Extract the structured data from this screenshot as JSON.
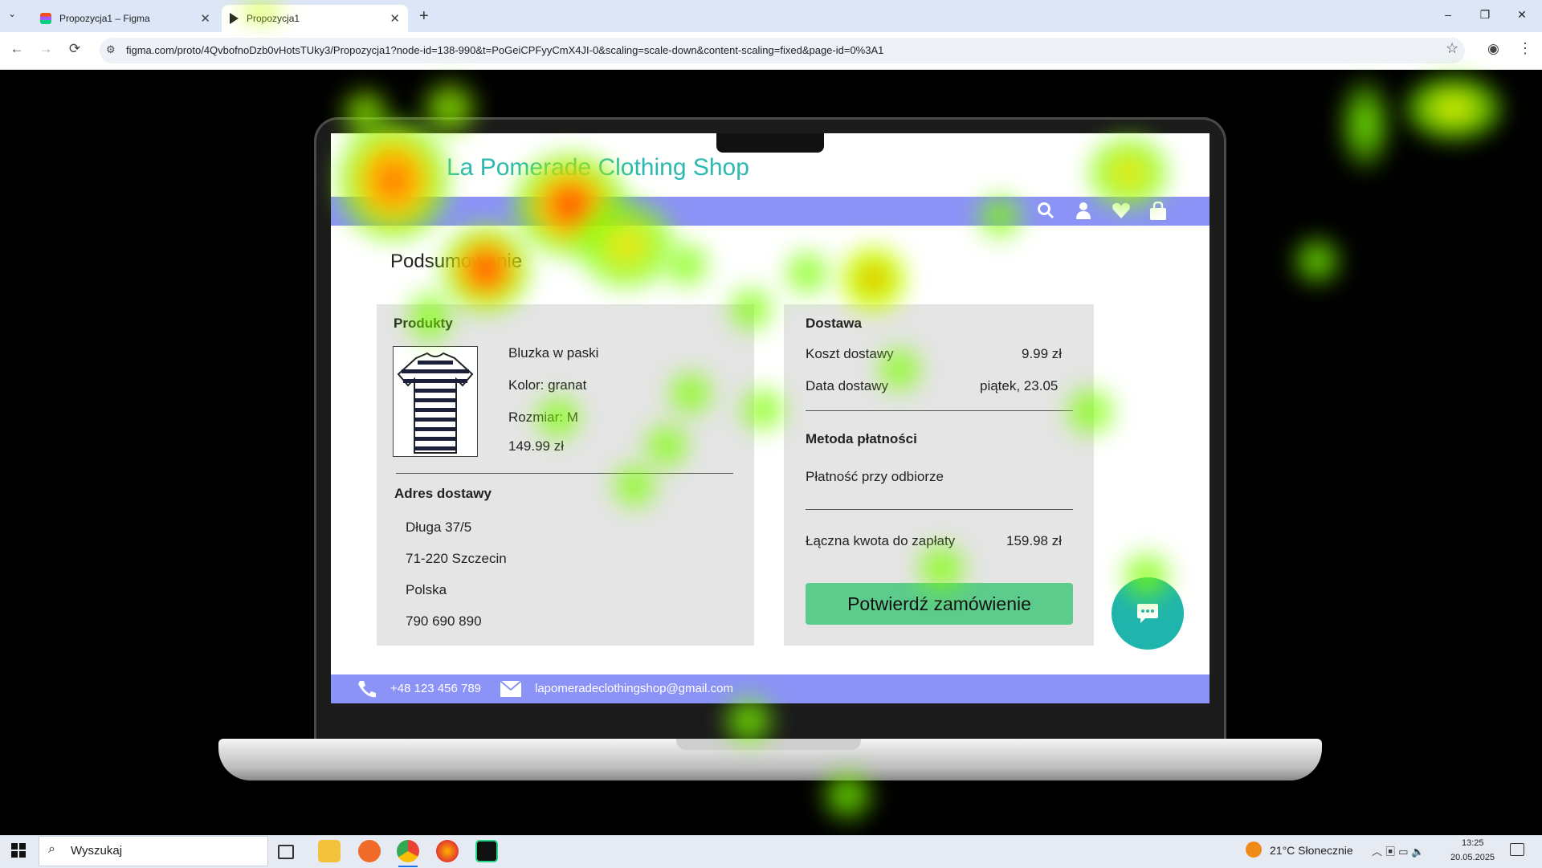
{
  "browser": {
    "tabs": [
      {
        "title": "Propozycja1 – Figma",
        "active": false
      },
      {
        "title": "Propozycja1",
        "active": true
      }
    ],
    "new_tab_symbol": "+",
    "close_symbol": "✕",
    "url": "figma.com/proto/4QvbofnoDzb0vHotsTUky3/Propozycja1?node-id=138-990&t=PoGeiCPFyyCmX4JI-0&scaling=scale-down&content-scaling=fixed&page-id=0%3A1",
    "nav": {
      "back": "←",
      "forward": "→",
      "reload": "⟳",
      "star": "☆",
      "profile": "◉",
      "menu": "⋮"
    },
    "window_controls": {
      "minimize": "–",
      "restore": "❐",
      "close": "✕"
    }
  },
  "shop": {
    "brand": "La Pomerade Clothing Shop",
    "page_title": "Podsumowanie",
    "icons": [
      "search-icon",
      "user-icon",
      "heart-icon",
      "bag-icon"
    ],
    "products": {
      "heading": "Produkty",
      "name": "Bluzka w paski",
      "color": "Kolor: granat",
      "size": "Rozmiar: M",
      "price": "149.99 zł"
    },
    "address": {
      "heading": "Adres dostawy",
      "street": "Długa 37/5",
      "city": "71-220 Szczecin",
      "country": "Polska",
      "phone": "790 690 890"
    },
    "delivery": {
      "heading": "Dostawa",
      "cost_label": "Koszt dostawy",
      "cost_value": "9.99 zł",
      "date_label": "Data dostawy",
      "date_value": "piątek, 23.05"
    },
    "payment": {
      "heading": "Metoda płatności",
      "method": "Płatność przy odbiorze"
    },
    "total": {
      "label": "Łączna kwota do zapłaty",
      "value": "159.98 zł"
    },
    "confirm_button": "Potwierdź zamówienie",
    "footer": {
      "phone": "+48 123 456 789",
      "email": "lapomeradeclothingshop@gmail.com"
    },
    "colors": {
      "brand_teal": "#2bb9b0",
      "nav_purple": "#8c93f7",
      "confirm_green": "#5ccb8c",
      "card_gray": "#e5e5e5"
    }
  },
  "taskbar": {
    "search_placeholder": "Wyszukaj",
    "weather": "21°C  Słonecznie",
    "time": "13:25",
    "date": "20.05.2025"
  }
}
